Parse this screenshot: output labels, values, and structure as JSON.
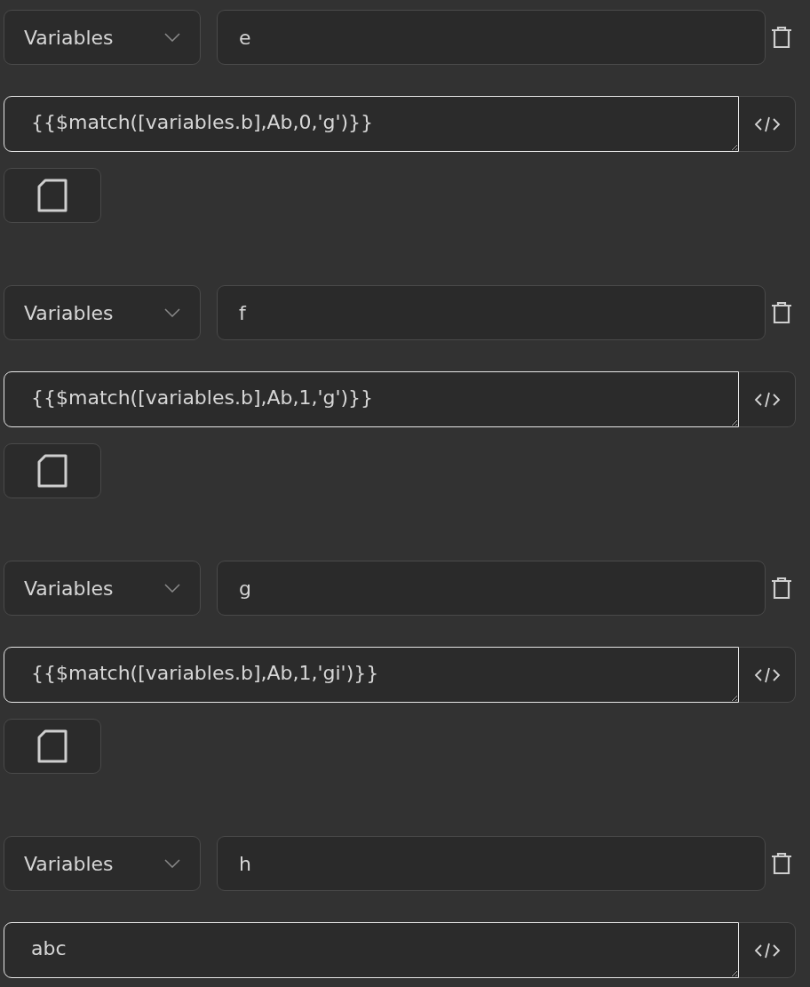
{
  "entries": [
    {
      "source": "Variables",
      "name": "e",
      "expression": "{{$match([variables.b],Ab,0,'g')}}",
      "has_doc_button": true
    },
    {
      "source": "Variables",
      "name": "f",
      "expression": "{{$match([variables.b],Ab,1,'g')}}",
      "has_doc_button": true
    },
    {
      "source": "Variables",
      "name": "g",
      "expression": "{{$match([variables.b],Ab,1,'gi')}}",
      "has_doc_button": true
    },
    {
      "source": "Variables",
      "name": "h",
      "expression": "abc",
      "has_doc_button": false
    }
  ]
}
